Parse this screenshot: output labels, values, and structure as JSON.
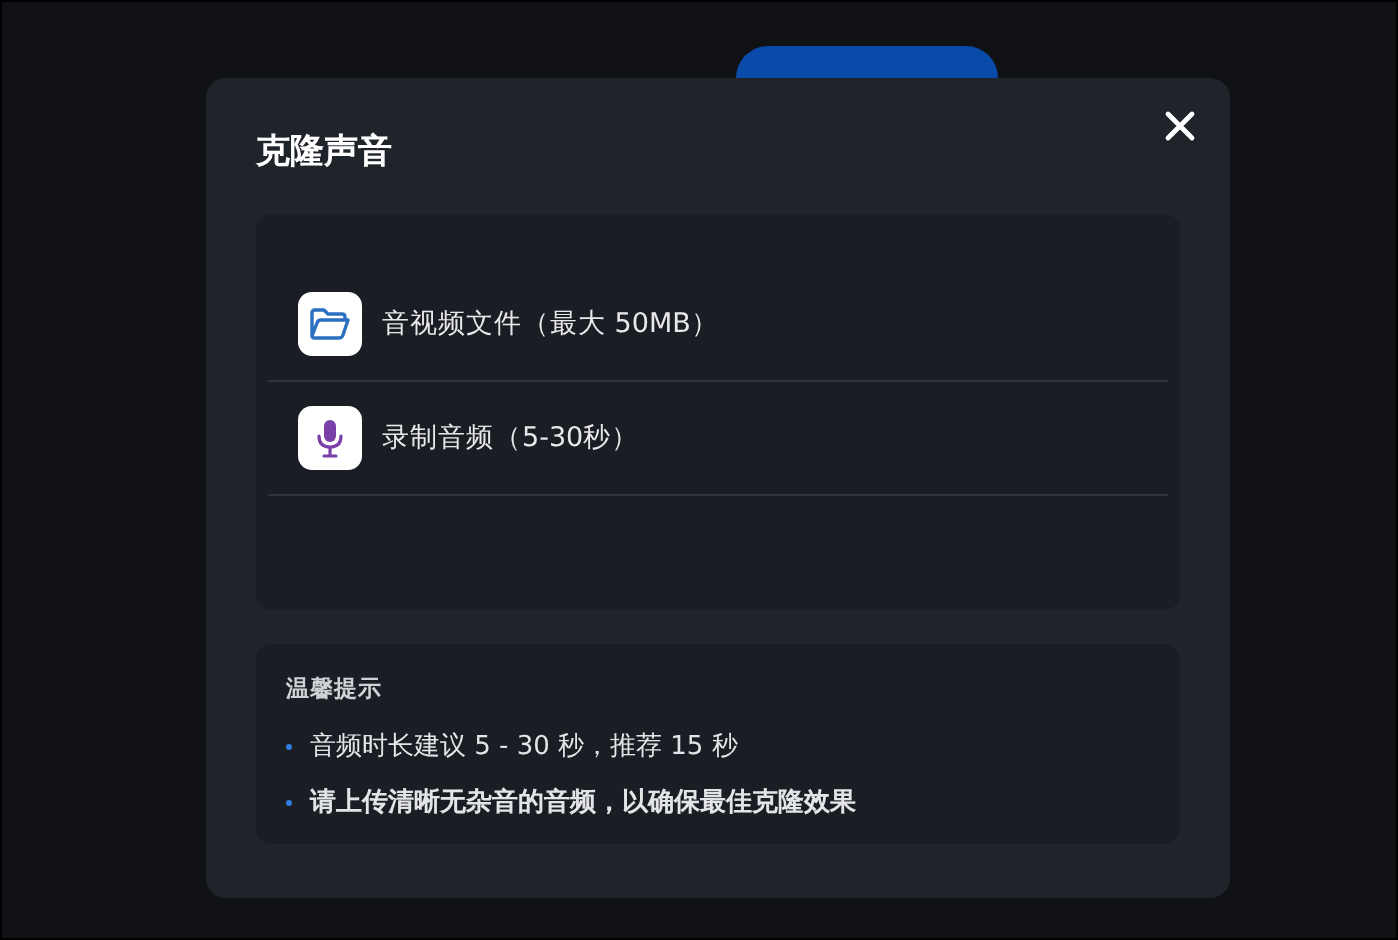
{
  "dialog": {
    "title": "克隆声音",
    "options": [
      {
        "kind": "file",
        "label": "音视频文件（最大 50MB）"
      },
      {
        "kind": "record",
        "label": "录制音频（5-30秒）"
      }
    ],
    "tips": {
      "heading": "温馨提示",
      "items": [
        {
          "text": "音频时长建议 5 - 30 秒，推荐 15 秒",
          "bold": false
        },
        {
          "text": "请上传清晰无杂音的音频，以确保最佳克隆效果",
          "bold": true
        }
      ]
    }
  }
}
